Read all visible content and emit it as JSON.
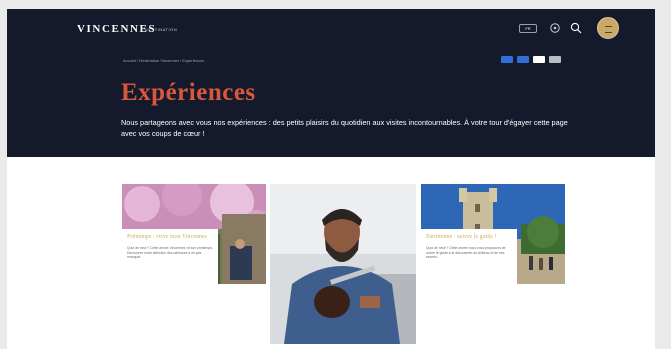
{
  "header": {
    "logo": "VINCENNES",
    "logo_sub": "DESTINATION",
    "lang": "FR",
    "icons": [
      "accessibility-icon",
      "search-icon",
      "menu-icon"
    ]
  },
  "breadcrumb": "Accueil / Destination Vincennes / Expériences",
  "share": {
    "colors": [
      "#2f6fd6",
      "#2f6fd6",
      "#ffffff",
      "#b9bdc6"
    ]
  },
  "hero": {
    "title": "Expériences",
    "intro": "Nous partageons avec vous nos expériences : des petits plaisirs du quotidien aux visites incontournables. À votre tour d'égayer cette page avec vos coups de cœur !"
  },
  "cards": [
    {
      "title": "Printemps : vivre mon Vincennes",
      "text": "Quoi de neuf ? Cette année Vincennes vit son printemps. Découvrez notre sélection des adresses à ne pas manquer."
    },
    {
      "title": "",
      "text": ""
    },
    {
      "title": "Patrimoine : suivez le guide !",
      "text": "Quoi de neuf ? Cette année nous vous proposons de suivre le guide à la découverte du château et de ses secrets."
    }
  ],
  "colors": {
    "hero_bg": "#141a2b",
    "title": "#d9573d",
    "card_title": "#c9b65a",
    "avatar": "#c9a86a"
  }
}
